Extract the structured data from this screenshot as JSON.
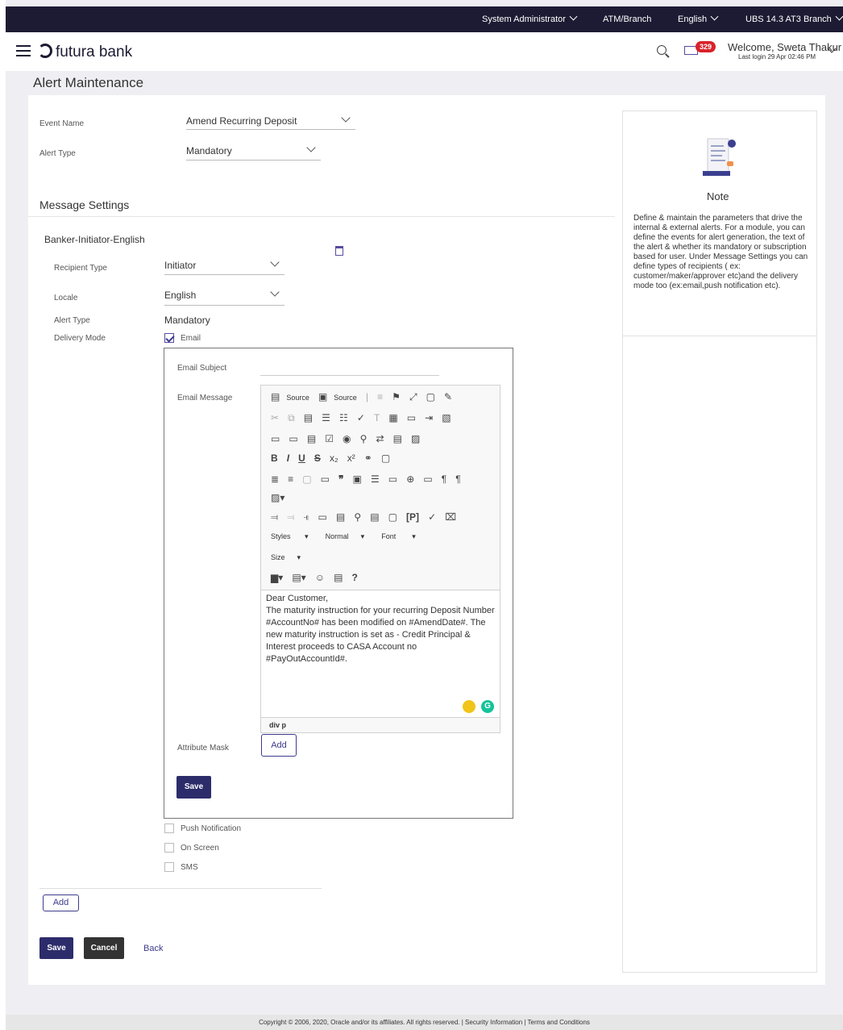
{
  "topbar": {
    "role": "System Administrator",
    "branch_type": "ATM/Branch",
    "language": "English",
    "branch": "UBS 14.3 AT3 Branch"
  },
  "header": {
    "brand": "futura bank",
    "mail_count": "329",
    "welcome": "Welcome, Sweta Thakur",
    "last_login": "Last login 29 Apr 02:46 PM"
  },
  "page": {
    "title": "Alert Maintenance"
  },
  "form": {
    "event_name_label": "Event Name",
    "event_name_value": "Amend Recurring Deposit",
    "alert_type_label": "Alert Type",
    "alert_type_value": "Mandatory"
  },
  "message_settings": {
    "title": "Message Settings",
    "subtitle": "Banker-Initiator-English",
    "recipient_type_label": "Recipient Type",
    "recipient_type_value": "Initiator",
    "locale_label": "Locale",
    "locale_value": "English",
    "alert_type_label": "Alert Type",
    "alert_type_value": "Mandatory",
    "delivery_mode_label": "Delivery Mode",
    "email_label": "Email",
    "email_checked": true,
    "push_label": "Push Notification",
    "onscreen_label": "On Screen",
    "sms_label": "SMS"
  },
  "email": {
    "subject_label": "Email Subject",
    "subject_value": "",
    "message_label": "Email Message",
    "attribute_mask_label": "Attribute Mask",
    "add_label": "Add",
    "save_label": "Save",
    "body_lines": [
      "Dear Customer,",
      "The maturity instruction for your recurring Deposit Number #AccountNo# has been modified on #AmendDate#. The new maturity instruction is set as - Credit Principal & Interest proceeds to CASA Account no #PayOutAccountId#."
    ],
    "status_path": "div  p"
  },
  "editor_toolbar": {
    "source1": "Source",
    "source2": "Source",
    "styles": "Styles",
    "format": "Normal",
    "font": "Font",
    "size": "Size"
  },
  "actions": {
    "add_label": "Add",
    "save_label": "Save",
    "cancel_label": "Cancel",
    "back_label": "Back"
  },
  "note": {
    "title": "Note",
    "text": "Define & maintain the parameters that drive the internal & external alerts. For a module, you can define the events for alert generation, the text of the alert & whether its mandatory or subscription based for user. Under Message Settings you can define types of recipients ( ex: customer/maker/approver etc)and the delivery mode too (ex:email,push notification etc)."
  },
  "footer": {
    "text": "Copyright © 2006, 2020, Oracle and/or its affiliates. All rights reserved. | Security Information | Terms and Conditions"
  }
}
